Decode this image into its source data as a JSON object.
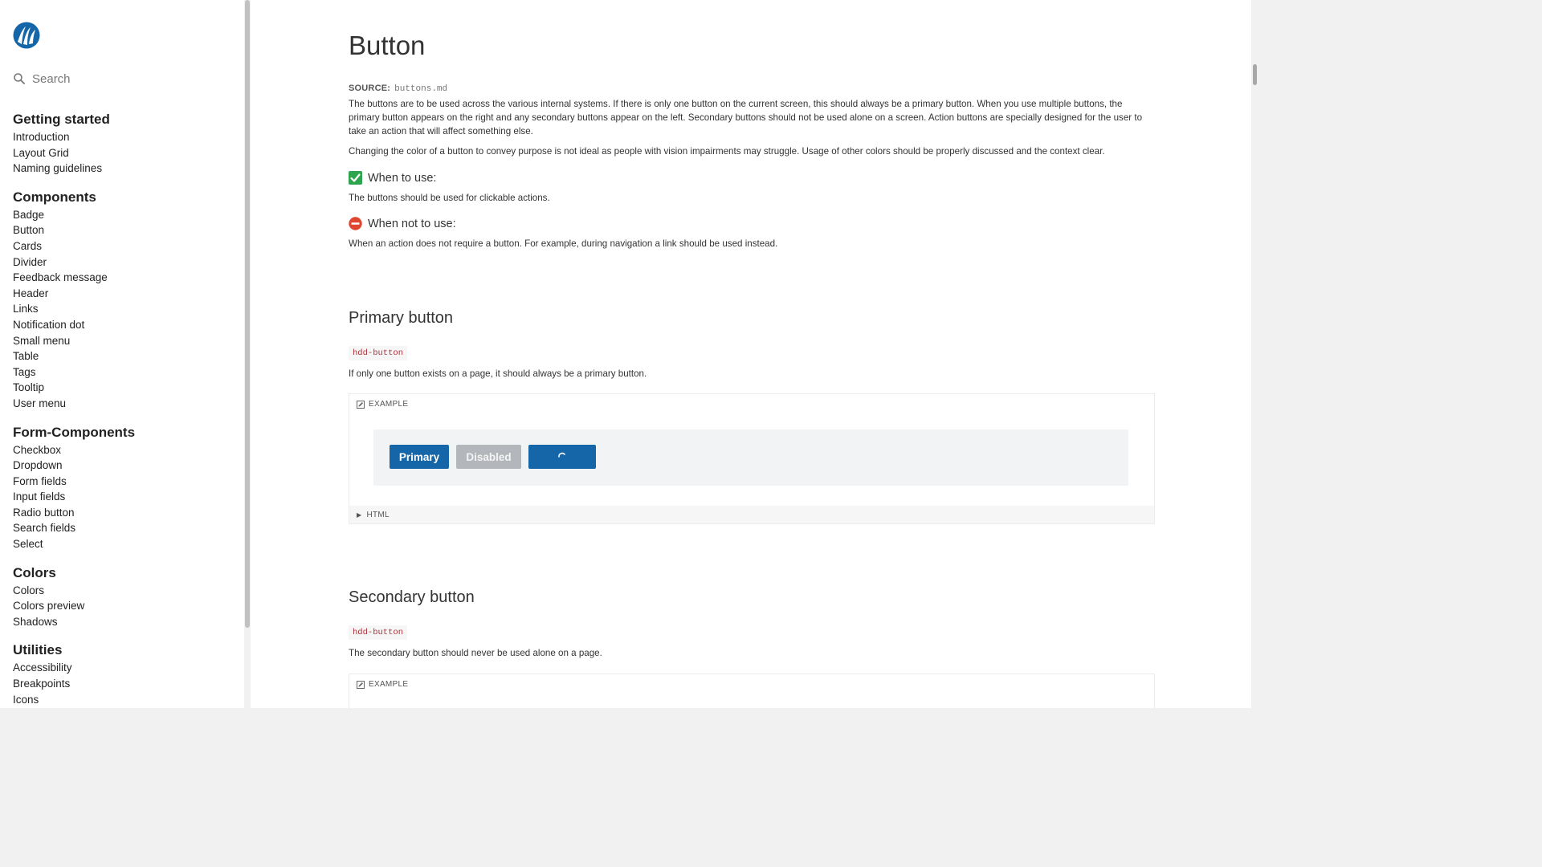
{
  "sidebar": {
    "search_placeholder": "Search",
    "sections": [
      {
        "heading": "Getting started",
        "items": [
          "Introduction",
          "Layout Grid",
          "Naming guidelines"
        ]
      },
      {
        "heading": "Components",
        "items": [
          "Badge",
          "Button",
          "Cards",
          "Divider",
          "Feedback message",
          "Header",
          "Links",
          "Notification dot",
          "Small menu",
          "Table",
          "Tags",
          "Tooltip",
          "User menu"
        ]
      },
      {
        "heading": "Form-Components",
        "items": [
          "Checkbox",
          "Dropdown",
          "Form fields",
          "Input fields",
          "Radio button",
          "Search fields",
          "Select"
        ]
      },
      {
        "heading": "Colors",
        "items": [
          "Colors",
          "Colors preview",
          "Shadows"
        ]
      },
      {
        "heading": "Utilities",
        "items": [
          "Accessibility",
          "Breakpoints",
          "Icons"
        ]
      }
    ]
  },
  "page": {
    "title": "Button",
    "source_label": "SOURCE:",
    "source_file": "buttons.md",
    "intro_1": "The buttons are to be used across the various internal systems. If there is only one button on the current screen, this should always be a primary button. When you use multiple buttons, the primary button appears on the right and any secondary buttons appear on the left. Secondary buttons should not be used alone on a screen. Action buttons are specially designed for the user to take an action that will affect something else.",
    "intro_2": "Changing the color of a button to convey purpose is not ideal as people with vision impairments may struggle. Usage of other colors should be properly discussed and the context clear.",
    "when_heading": "When to use:",
    "when_text": "The buttons should be used for clickable actions.",
    "whennot_heading": "When not to use:",
    "whennot_text": "When an action does not require a button. For example, during navigation a link should be used instead."
  },
  "primary_section": {
    "title": "Primary button",
    "tag": "hdd-button",
    "description": "If only one button exists on a page, it should always be a primary button.",
    "example_label": "EXAMPLE",
    "buttons": {
      "primary": "Primary",
      "disabled": "Disabled"
    },
    "html_toggle": "HTML"
  },
  "secondary_section": {
    "title": "Secondary button",
    "tag": "hdd-button",
    "description": "The secondary button should never be used alone on a page.",
    "example_label": "EXAMPLE"
  },
  "colors": {
    "brand_blue": "#1466a8",
    "disabled_gray": "#b3b6ba",
    "code_red": "#b0313a",
    "check_green": "#2ea44f",
    "stop_red": "#e0452f"
  },
  "icons": {
    "logo": "brand-logo-icon",
    "search": "search-icon",
    "when": "check-mark-icon",
    "whennot": "no-entry-icon",
    "example": "edit-icon",
    "html_toggle": "caret-right-icon",
    "loading": "spinner-icon"
  }
}
